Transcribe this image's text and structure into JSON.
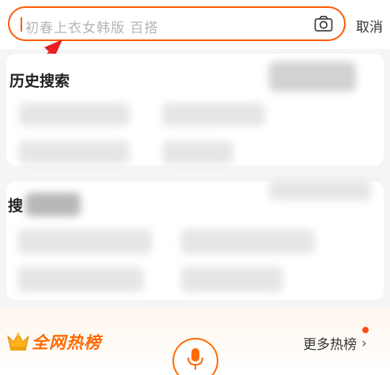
{
  "search": {
    "placeholder": "初春上衣女韩版 百搭",
    "cancel_label": "取消"
  },
  "history": {
    "title": "历史搜索"
  },
  "discover": {
    "title_fragment": "搜"
  },
  "hot": {
    "title": "全网热榜",
    "more_label": "更多热榜",
    "more_chevron": "›"
  },
  "colors": {
    "accent": "#ff5a00",
    "arrow": "#e82020"
  },
  "icons": {
    "camera": "camera-icon",
    "crown": "crown-icon",
    "mic": "microphone-icon"
  }
}
